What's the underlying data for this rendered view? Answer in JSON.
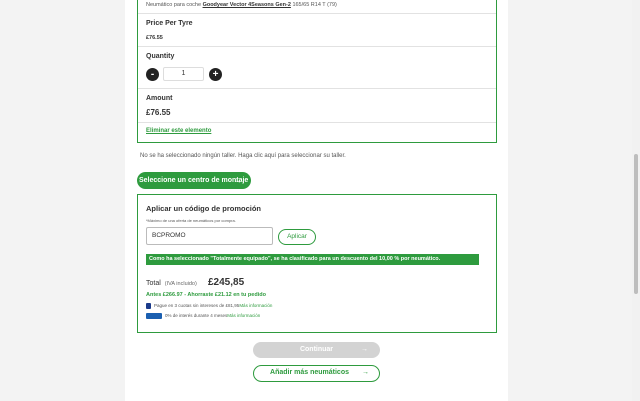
{
  "item": {
    "tyre_prefix": "Neumático para coche",
    "tyre_name": "Goodyear Vector 4Seasons Gen-2",
    "tyre_spec": "165/65 R14 T (79)",
    "price_label": "Price Per Tyre",
    "price_value": "£76.55",
    "quantity_label": "Quantity",
    "quantity_value": "1",
    "minus": "-",
    "plus": "+",
    "amount_label": "Amount",
    "amount_value": "£76.55",
    "remove_link": "Eliminar este elemento"
  },
  "workshop": {
    "notice": "No se ha seleccionado ningún taller. Haga clic aquí para seleccionar su taller.",
    "select_button": "Seleccione un centro de montaje",
    "arrow": "→"
  },
  "promo": {
    "title": "Aplicar un código de promoción",
    "note": "*Máximo de una oferta de neumáticos por compra.",
    "code_value": "BCPROMO",
    "apply_button": "Aplicar",
    "message": "Como ha seleccionado \"Totalmente equipado\", se ha clasificado para un descuento del 10,00 % por neumático."
  },
  "totals": {
    "total_label": "Total",
    "iva": "(IVA incluido)",
    "total_value": "£245,85",
    "before": "Antes £266.97 - Ahorraste £21.12 en tu pedido",
    "pay1_text": "Pague en 3 cuotas sin intereses de £81,95",
    "pay2_text": "0% de interés durante 4 meses",
    "more_info": "Más información"
  },
  "actions": {
    "continue": "Continuar",
    "add_more": "Añadir más neumáticos",
    "arrow": "→"
  },
  "colors": {
    "accent": "#2e9b3e",
    "disabled": "#d3d3d3"
  }
}
